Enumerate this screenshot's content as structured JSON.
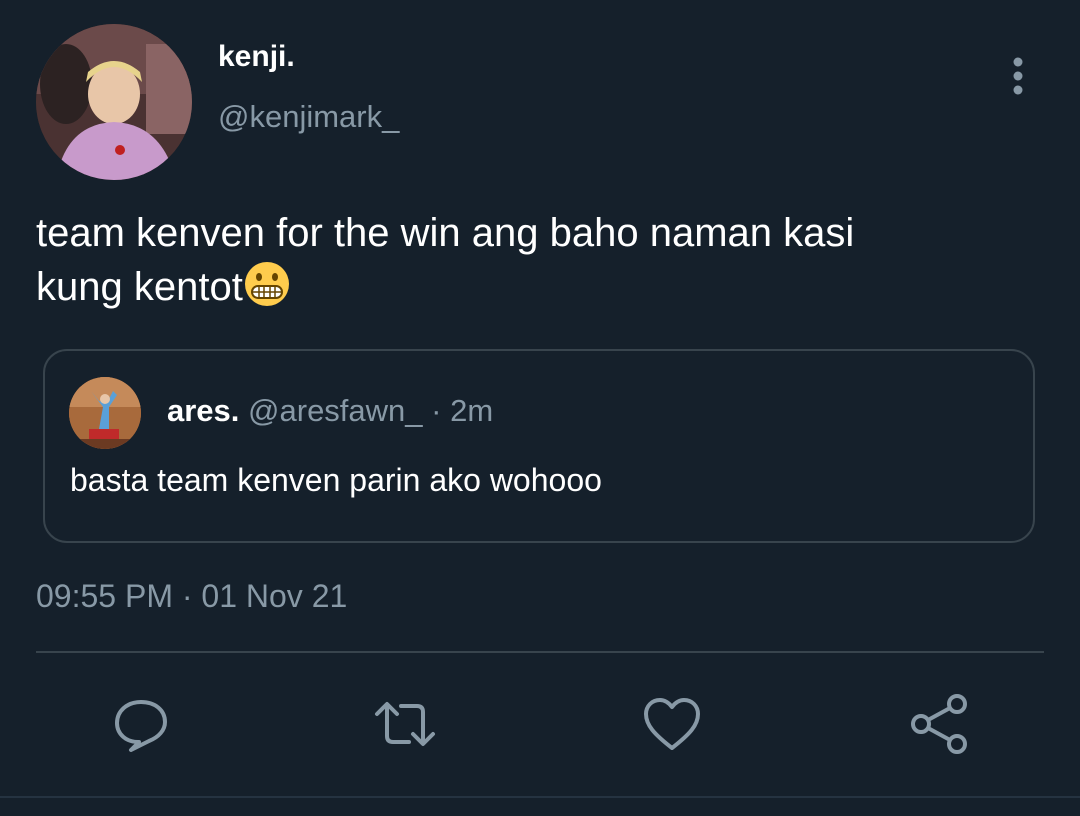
{
  "tweet": {
    "author": {
      "display_name": "kenji.",
      "handle": "@kenjimark_"
    },
    "text_line_1": "team kenven for the win ang baho naman kasi",
    "text_line_2": "kung kentot",
    "emoji": "grimacing-face",
    "timestamp": "09:55 PM · 01 Nov 21"
  },
  "quoted_tweet": {
    "display_name": "ares.",
    "handle": "@aresfawn_",
    "separator": "·",
    "time": "2m",
    "text": "basta team kenven parin ako wohooo"
  },
  "actions": {
    "icons": [
      "reply-icon",
      "retweet-icon",
      "like-icon",
      "share-icon"
    ]
  },
  "colors": {
    "background": "#15202b",
    "secondary_text": "#8899a6",
    "border": "#38444d"
  }
}
